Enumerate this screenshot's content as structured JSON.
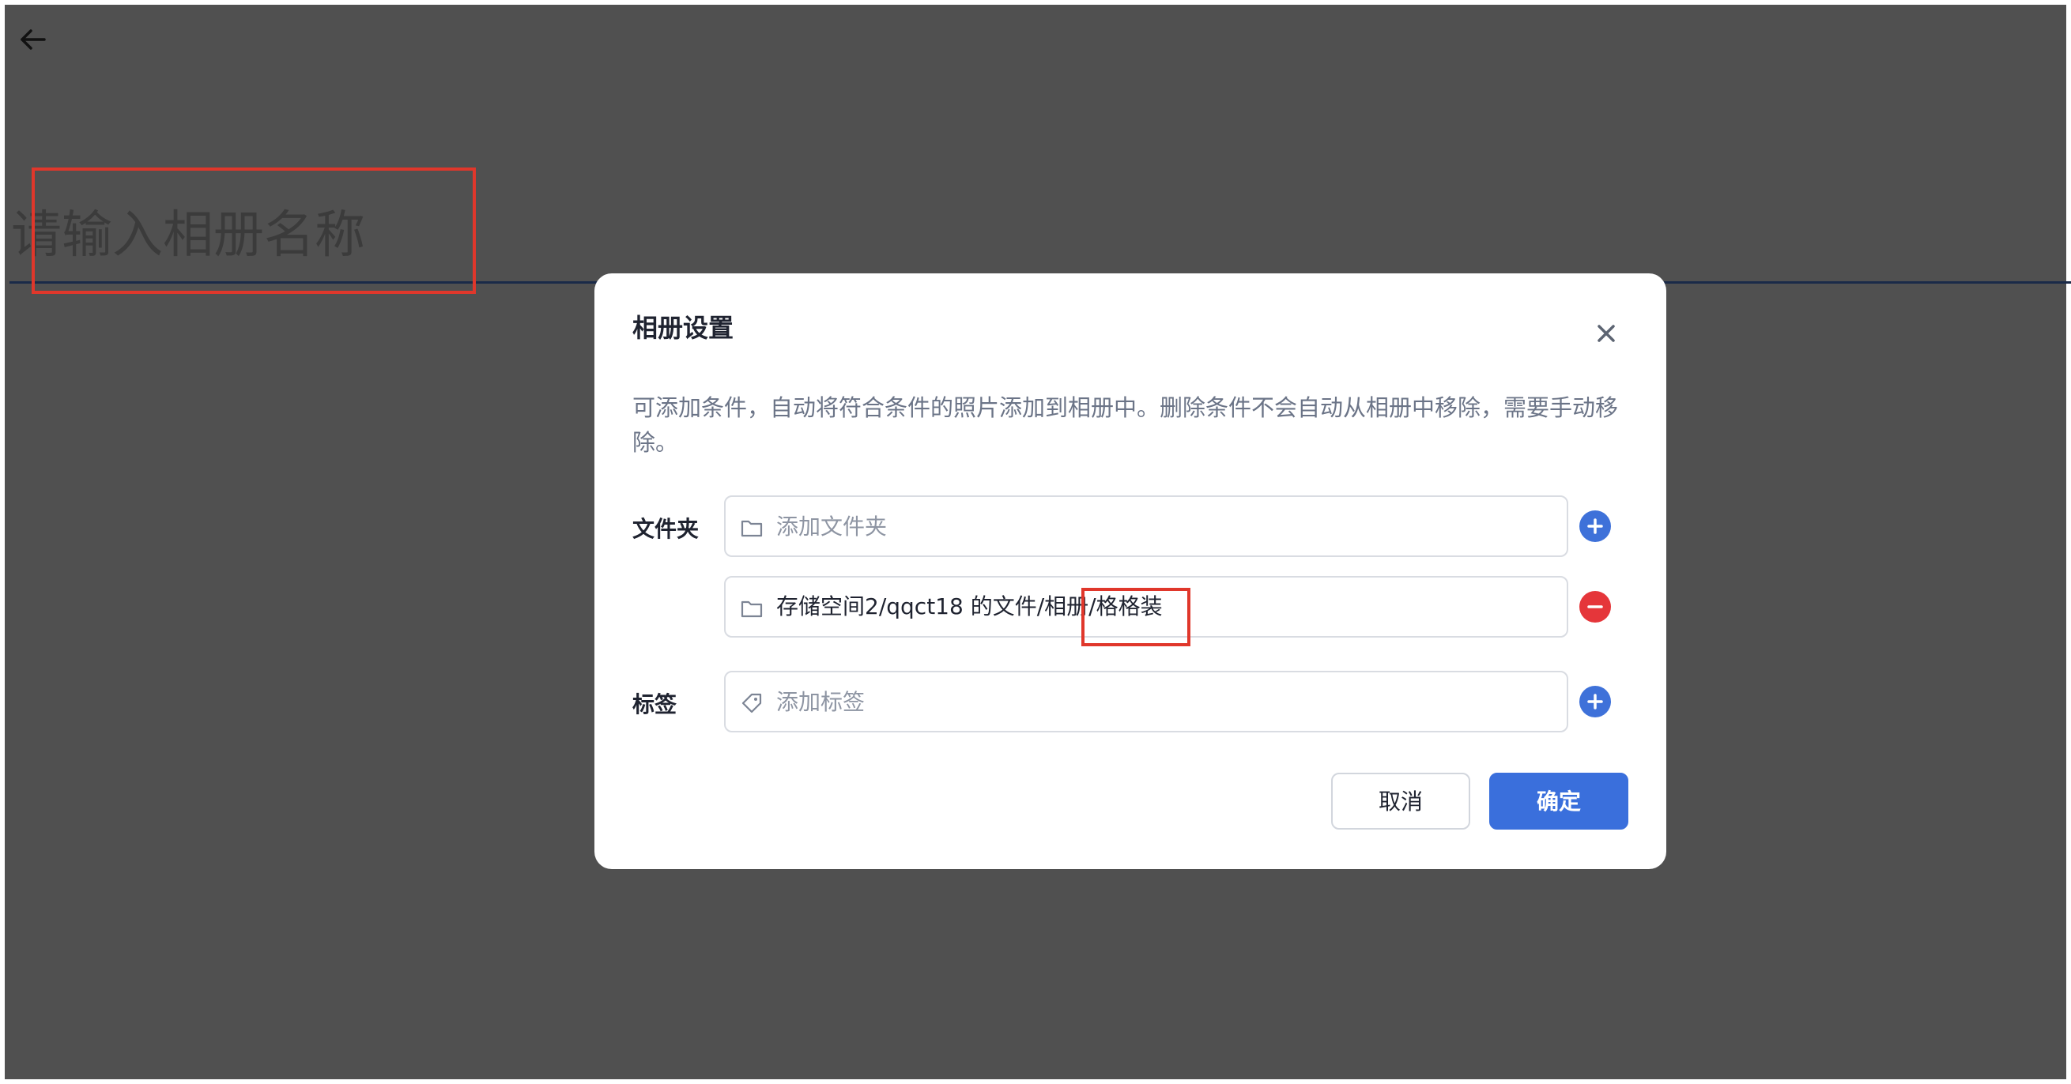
{
  "page": {
    "album_name_placeholder": "请输入相册名称"
  },
  "modal": {
    "title": "相册设置",
    "description": "可添加条件，自动将符合条件的照片添加到相册中。删除条件不会自动从相册中移除，需要手动移除。",
    "folder_label": "文件夹",
    "folder_placeholder": "添加文件夹",
    "folder_items": [
      {
        "path": "存储空间2/qqct18 的文件/相册/格格装"
      }
    ],
    "tag_label": "标签",
    "tag_placeholder": "添加标签",
    "cancel_label": "取消",
    "confirm_label": "确定"
  },
  "icons": {
    "back": "arrow-left-icon",
    "close": "close-icon",
    "folder": "folder-icon",
    "tag": "tag-icon",
    "add": "plus-circle-icon",
    "remove": "minus-circle-icon"
  },
  "colors": {
    "accent": "#3a6fdc",
    "danger": "#e5363a",
    "overlay": "#505050",
    "annotation": "#e0372b"
  }
}
